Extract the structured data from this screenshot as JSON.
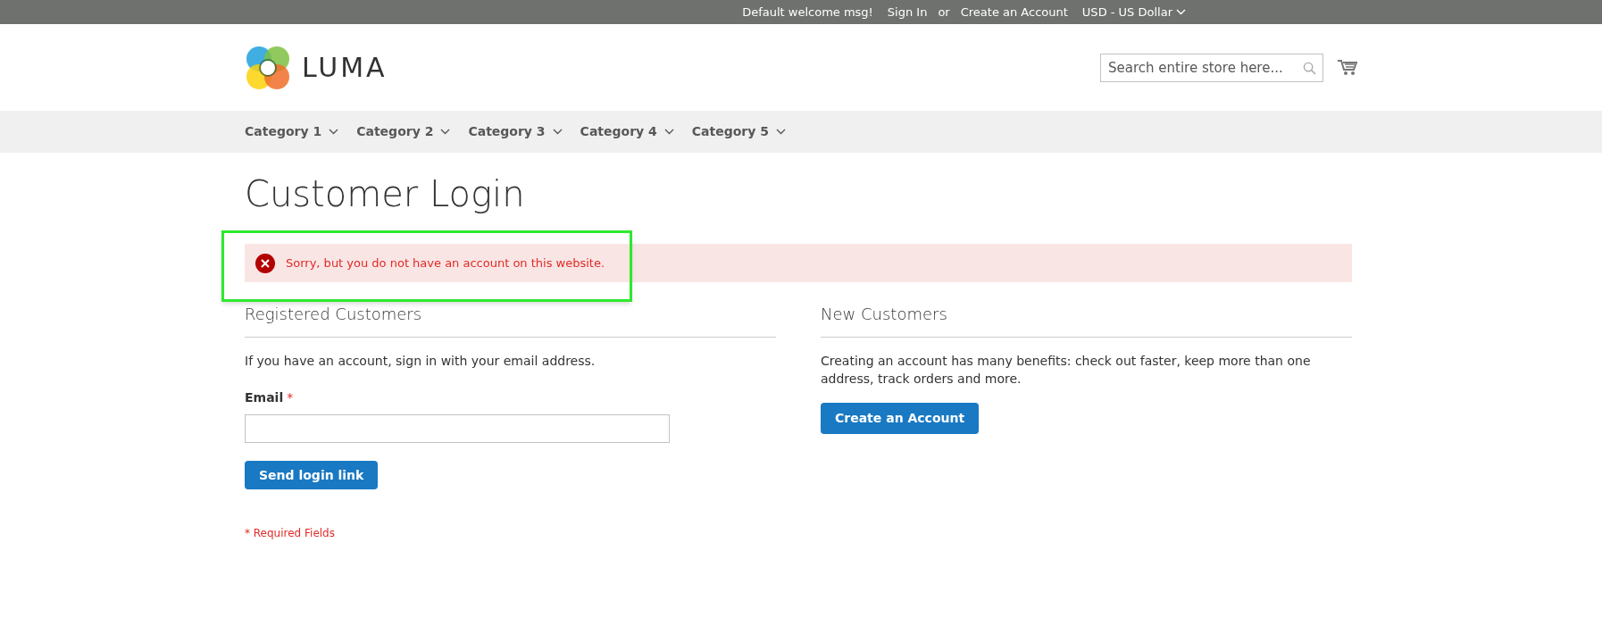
{
  "top_bar": {
    "welcome": "Default welcome msg!",
    "links": [
      {
        "label": "Sign In"
      },
      {
        "label": "or",
        "kind": "text"
      },
      {
        "label": "Create an Account"
      }
    ],
    "currency": "USD - US Dollar"
  },
  "header": {
    "logo_text": "LUMA",
    "search": {
      "placeholder": "Search entire store here..."
    }
  },
  "nav": [
    {
      "label": "Category 1"
    },
    {
      "label": "Category 2"
    },
    {
      "label": "Category 3"
    },
    {
      "label": "Category 4"
    },
    {
      "label": "Category 5"
    }
  ],
  "page_title": "Customer Login",
  "error_message": "Sorry, but you do not have an account on this website.",
  "registered": {
    "title": "Registered Customers",
    "intro": "If you have an account, sign in with your email address.",
    "email_label": "Email",
    "required_mark": "*",
    "button": "Send login link",
    "required_note": "* Required Fields"
  },
  "new_customers": {
    "title": "New Customers",
    "text": "Creating an account has many benefits: check out faster, keep more than one address, track orders and more.",
    "button": "Create an Account"
  }
}
